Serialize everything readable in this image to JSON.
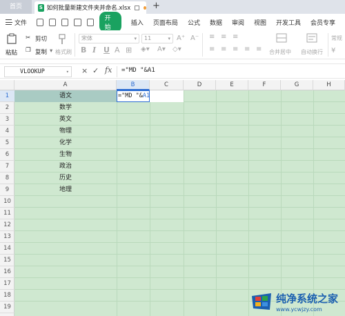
{
  "tabs": {
    "home": "首页",
    "file_name": "如何批量新建文件夹并命名.xlsx",
    "add": "+"
  },
  "menu": {
    "file": "文件",
    "items": [
      "开始",
      "插入",
      "页面布局",
      "公式",
      "数据",
      "审阅",
      "视图",
      "开发工具",
      "会员专享"
    ],
    "active": "开始"
  },
  "ribbon": {
    "paste": "粘贴",
    "cut": "剪切",
    "copy": "复制",
    "format_painter": "格式刷",
    "font_name": "宋体",
    "font_size": "11",
    "bold": "B",
    "italic": "I",
    "underline": "U",
    "merge_center": "合并居中",
    "wrap_text": "自动换行",
    "number_format": "常规"
  },
  "formula_bar": {
    "name_box": "VLOOKUP",
    "cancel_icon": "×",
    "confirm_icon": "✓",
    "fx": "fx",
    "formula": "=\"MD \"&A1"
  },
  "grid": {
    "columns": [
      "A",
      "B",
      "C",
      "D",
      "E",
      "F",
      "G",
      "H"
    ],
    "active_column": "B",
    "rows": [
      "1",
      "2",
      "3",
      "4",
      "5",
      "6",
      "7",
      "8",
      "9",
      "10",
      "11",
      "12",
      "13",
      "14",
      "15",
      "16",
      "17",
      "18",
      "19"
    ],
    "active_row": "1",
    "column_a": [
      "语文",
      "数学",
      "英文",
      "物理",
      "化学",
      "生物",
      "政治",
      "历史",
      "地理"
    ],
    "b1_edit_prefix": "=\"MD \"&",
    "b1_edit_ref": "A1",
    "sheet_bg": "#cfe8d0",
    "accent": "#2a6bd1"
  },
  "watermark": {
    "title": "纯净系统之家",
    "url": "www.ycwjzy.com"
  }
}
